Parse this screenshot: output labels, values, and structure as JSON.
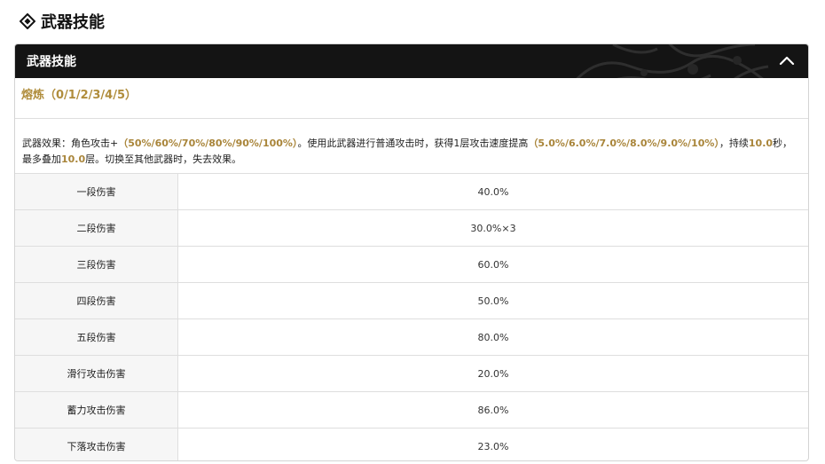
{
  "section": {
    "title": "武器技能",
    "icon": "diamond-icon"
  },
  "panel": {
    "title": "武器技能",
    "collapse_icon": "chevron-up-icon",
    "refine": "熔炼（0/1/2/3/4/5）",
    "effect": {
      "p1": "武器效果：角色攻击+",
      "h1": "（50%/60%/70%/80%/90%/100%）",
      "p2": "。使用此武器进行普通攻击时，获得1层攻击速度提高",
      "h2": "（5.0%/6.0%/7.0%/8.0%/9.0%/10%）",
      "p3": "，持续",
      "h3": "10.0",
      "p4": "秒，最多叠加",
      "h4": "10.0",
      "p5": "层。切换至其他武器时，失去效果。"
    },
    "rows": [
      {
        "label": "一段伤害",
        "value": "40.0%"
      },
      {
        "label": "二段伤害",
        "value": "30.0%×3"
      },
      {
        "label": "三段伤害",
        "value": "60.0%"
      },
      {
        "label": "四段伤害",
        "value": "50.0%"
      },
      {
        "label": "五段伤害",
        "value": "80.0%"
      },
      {
        "label": "滑行攻击伤害",
        "value": "20.0%"
      },
      {
        "label": "蓄力攻击伤害",
        "value": "86.0%"
      },
      {
        "label": "下落攻击伤害",
        "value": "23.0%"
      }
    ]
  },
  "colors": {
    "header_bg": "#141414",
    "highlight": "#a9853a",
    "label_bg": "#f6f6f6"
  }
}
